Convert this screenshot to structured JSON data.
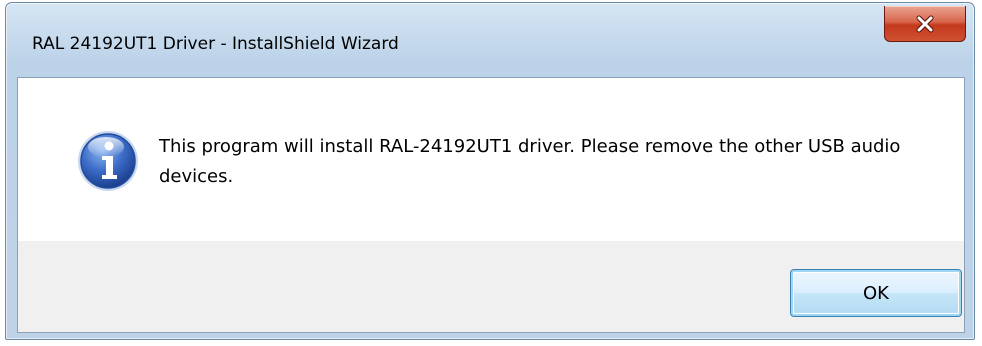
{
  "window": {
    "title": "RAL 24192UT1 Driver - InstallShield Wizard",
    "close_icon": "close-x-icon"
  },
  "dialog": {
    "icon": "information-icon",
    "message": "This program will install RAL-24192UT1 driver. Please remove the other USB audio devices.",
    "ok_label": "OK"
  },
  "colors": {
    "titlebar": "#c4d9ec",
    "close_button": "#c3391c",
    "content_background": "#ffffff",
    "button_area": "#f0f0f0",
    "info_icon": "#2f5fb8"
  }
}
